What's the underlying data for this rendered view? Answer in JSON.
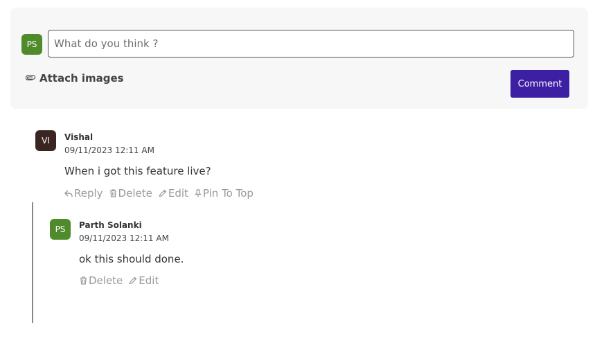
{
  "composer": {
    "avatar_initials": "PS",
    "avatar_color": "#4f8a2b",
    "input_placeholder": "What do you think ?",
    "attach_label": "Attach images",
    "comment_button": "Comment",
    "button_color": "#3d1fa3"
  },
  "comments": [
    {
      "avatar_initials": "VI",
      "avatar_color": "#3b2522",
      "author": "Vishal",
      "timestamp": "09/11/2023 12:11 AM",
      "text": "When i got this feature live?",
      "actions": [
        "Reply",
        "Delete",
        "Edit",
        "Pin To Top"
      ]
    }
  ],
  "replies": [
    {
      "avatar_initials": "PS",
      "avatar_color": "#4f8a2b",
      "author": "Parth Solanki",
      "timestamp": "09/11/2023 12:11 AM",
      "text": "ok this should done.",
      "actions": [
        "Delete",
        "Edit"
      ]
    }
  ]
}
